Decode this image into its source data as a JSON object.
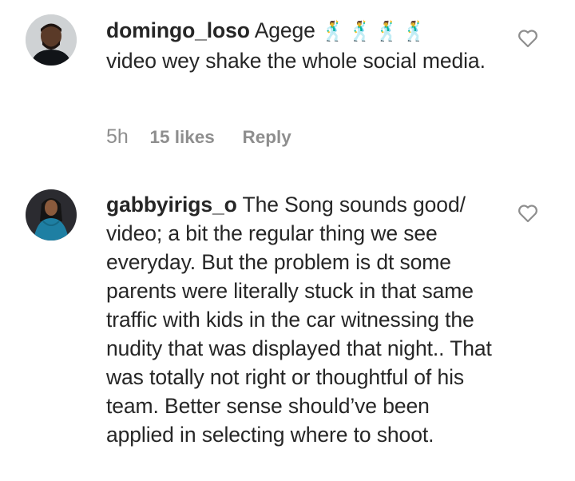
{
  "comments": [
    {
      "username": "domingo_loso",
      "text_line1": "Agege",
      "emojis": "🕺🕺🕺🕺",
      "text_rest": "video wey shake the whole social media.",
      "time": "5h",
      "likes": "15 likes",
      "reply_label": "Reply",
      "like_icon": "heart-outline-icon"
    },
    {
      "username": "gabbyirigs_o",
      "text": "The Song sounds good/ video; a bit the regular thing we see everyday. But the problem is dt some parents were literally stuck in that same traffic with kids in the car witnessing the nudity that was displayed that night.. That was totally not right or thoughtful of his team. Better sense should’ve been applied in selecting where to shoot.",
      "like_icon": "heart-outline-icon"
    }
  ]
}
